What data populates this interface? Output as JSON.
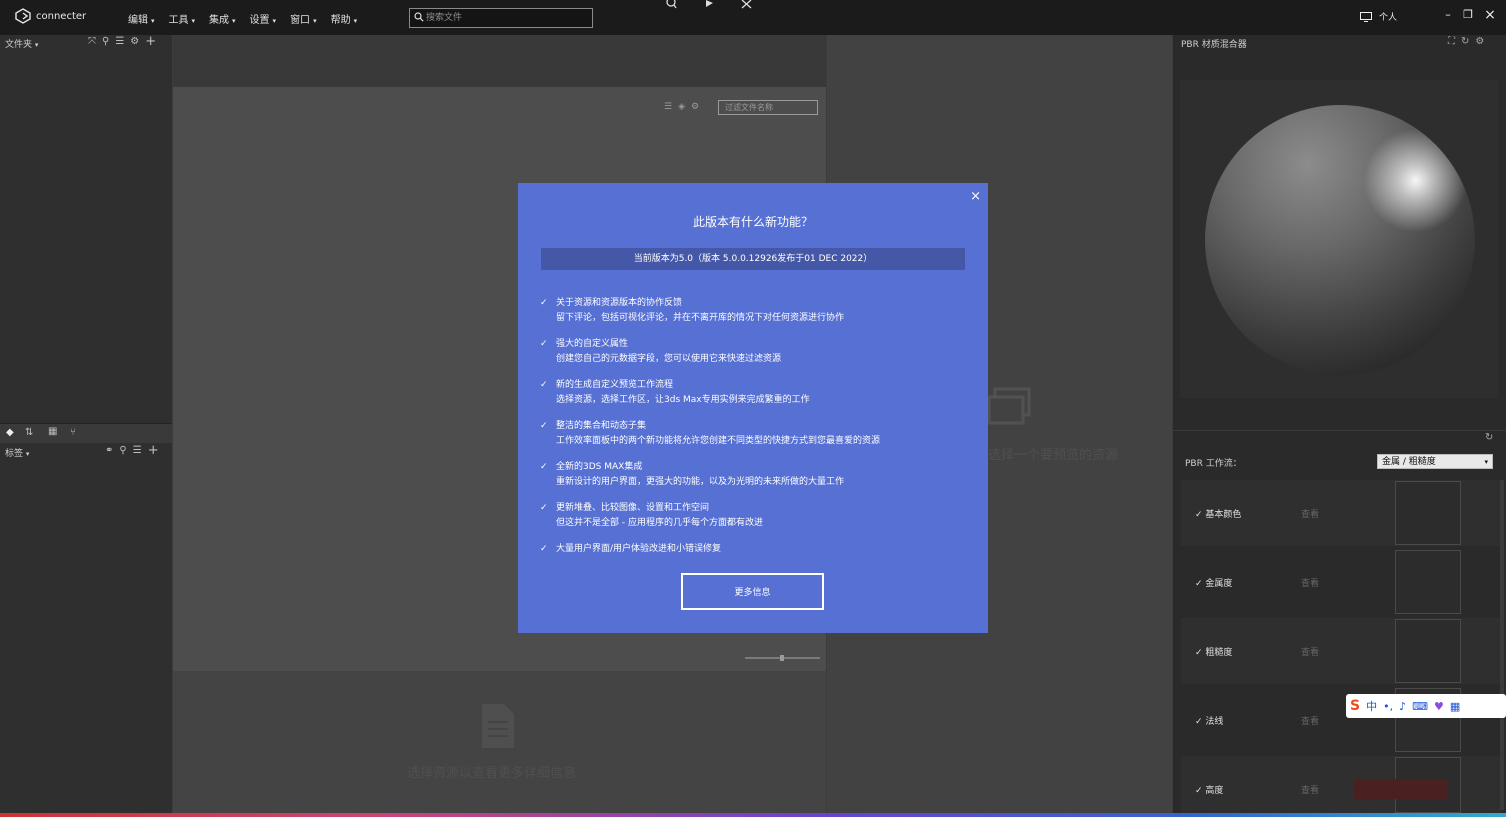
{
  "app": {
    "name": "connecter"
  },
  "menu": [
    {
      "label": "编辑"
    },
    {
      "label": "工具"
    },
    {
      "label": "集成"
    },
    {
      "label": "设置"
    },
    {
      "label": "窗口"
    },
    {
      "label": "帮助"
    }
  ],
  "search": {
    "placeholder": "搜索文件"
  },
  "workspace": {
    "label": "个人"
  },
  "folders": {
    "header": "文件夹"
  },
  "tags": {
    "header": "标签"
  },
  "content": {
    "filter_placeholder": "过滤文件名称",
    "preview_empty": "选择一个要预览的资源",
    "detail_empty": "选择资源以查看更多详细信息"
  },
  "pbr": {
    "header": "PBR 材质混合器",
    "workflow_label": "PBR 工作流：",
    "workflow_value": "金属 / 粗糙度",
    "view_label": "查看",
    "channels": [
      {
        "label": "基本颜色"
      },
      {
        "label": "金属度"
      },
      {
        "label": "粗糙度"
      },
      {
        "label": "法线"
      },
      {
        "label": "高度"
      }
    ]
  },
  "dialog": {
    "title": "此版本有什么新功能？",
    "version": "当前版本为5.0（版本 5.0.0.12926发布于01 DEC 2022）",
    "features": [
      {
        "title": "关于资源和资源版本的协作反馈",
        "desc": "留下评论，包括可视化评论，并在不离开库的情况下对任何资源进行协作"
      },
      {
        "title": "强大的自定义属性",
        "desc": "创建您自己的元数据字段，您可以使用它来快速过滤资源"
      },
      {
        "title": "新的生成自定义预览工作流程",
        "desc": "选择资源，选择工作区，让3ds Max专用实例来完成繁重的工作"
      },
      {
        "title": "整洁的集合和动态子集",
        "desc": "工作效率面板中的两个新功能将允许您创建不同类型的快捷方式到您最喜爱的资源"
      },
      {
        "title": "全新的3DS MAX集成",
        "desc": "重新设计的用户界面，更强大的功能，以及为光明的未来所做的大量工作"
      },
      {
        "title": "更新堆叠、比较图像、设置和工作空间",
        "desc": "但这并不是全部 - 应用程序的几乎每个方面都有改进"
      },
      {
        "title": "大量用户界面/用户体验改进和小错误修复",
        "desc": ""
      }
    ],
    "button": "更多信息"
  },
  "ime": {
    "label": "中"
  },
  "icons": {
    "check": "✓",
    "close": "×",
    "caret": "▾",
    "plus": "+",
    "minimize": "–",
    "restore": "❐"
  }
}
